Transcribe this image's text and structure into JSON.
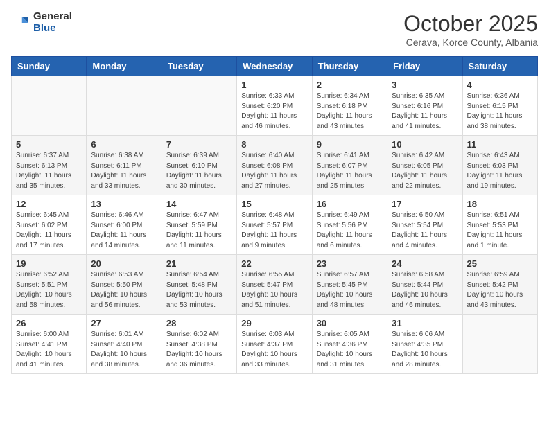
{
  "logo": {
    "general": "General",
    "blue": "Blue"
  },
  "title": "October 2025",
  "subtitle": "Cerava, Korce County, Albania",
  "days_of_week": [
    "Sunday",
    "Monday",
    "Tuesday",
    "Wednesday",
    "Thursday",
    "Friday",
    "Saturday"
  ],
  "weeks": [
    [
      {
        "day": "",
        "info": ""
      },
      {
        "day": "",
        "info": ""
      },
      {
        "day": "",
        "info": ""
      },
      {
        "day": "1",
        "info": "Sunrise: 6:33 AM\nSunset: 6:20 PM\nDaylight: 11 hours and 46 minutes."
      },
      {
        "day": "2",
        "info": "Sunrise: 6:34 AM\nSunset: 6:18 PM\nDaylight: 11 hours and 43 minutes."
      },
      {
        "day": "3",
        "info": "Sunrise: 6:35 AM\nSunset: 6:16 PM\nDaylight: 11 hours and 41 minutes."
      },
      {
        "day": "4",
        "info": "Sunrise: 6:36 AM\nSunset: 6:15 PM\nDaylight: 11 hours and 38 minutes."
      }
    ],
    [
      {
        "day": "5",
        "info": "Sunrise: 6:37 AM\nSunset: 6:13 PM\nDaylight: 11 hours and 35 minutes."
      },
      {
        "day": "6",
        "info": "Sunrise: 6:38 AM\nSunset: 6:11 PM\nDaylight: 11 hours and 33 minutes."
      },
      {
        "day": "7",
        "info": "Sunrise: 6:39 AM\nSunset: 6:10 PM\nDaylight: 11 hours and 30 minutes."
      },
      {
        "day": "8",
        "info": "Sunrise: 6:40 AM\nSunset: 6:08 PM\nDaylight: 11 hours and 27 minutes."
      },
      {
        "day": "9",
        "info": "Sunrise: 6:41 AM\nSunset: 6:07 PM\nDaylight: 11 hours and 25 minutes."
      },
      {
        "day": "10",
        "info": "Sunrise: 6:42 AM\nSunset: 6:05 PM\nDaylight: 11 hours and 22 minutes."
      },
      {
        "day": "11",
        "info": "Sunrise: 6:43 AM\nSunset: 6:03 PM\nDaylight: 11 hours and 19 minutes."
      }
    ],
    [
      {
        "day": "12",
        "info": "Sunrise: 6:45 AM\nSunset: 6:02 PM\nDaylight: 11 hours and 17 minutes."
      },
      {
        "day": "13",
        "info": "Sunrise: 6:46 AM\nSunset: 6:00 PM\nDaylight: 11 hours and 14 minutes."
      },
      {
        "day": "14",
        "info": "Sunrise: 6:47 AM\nSunset: 5:59 PM\nDaylight: 11 hours and 11 minutes."
      },
      {
        "day": "15",
        "info": "Sunrise: 6:48 AM\nSunset: 5:57 PM\nDaylight: 11 hours and 9 minutes."
      },
      {
        "day": "16",
        "info": "Sunrise: 6:49 AM\nSunset: 5:56 PM\nDaylight: 11 hours and 6 minutes."
      },
      {
        "day": "17",
        "info": "Sunrise: 6:50 AM\nSunset: 5:54 PM\nDaylight: 11 hours and 4 minutes."
      },
      {
        "day": "18",
        "info": "Sunrise: 6:51 AM\nSunset: 5:53 PM\nDaylight: 11 hours and 1 minute."
      }
    ],
    [
      {
        "day": "19",
        "info": "Sunrise: 6:52 AM\nSunset: 5:51 PM\nDaylight: 10 hours and 58 minutes."
      },
      {
        "day": "20",
        "info": "Sunrise: 6:53 AM\nSunset: 5:50 PM\nDaylight: 10 hours and 56 minutes."
      },
      {
        "day": "21",
        "info": "Sunrise: 6:54 AM\nSunset: 5:48 PM\nDaylight: 10 hours and 53 minutes."
      },
      {
        "day": "22",
        "info": "Sunrise: 6:55 AM\nSunset: 5:47 PM\nDaylight: 10 hours and 51 minutes."
      },
      {
        "day": "23",
        "info": "Sunrise: 6:57 AM\nSunset: 5:45 PM\nDaylight: 10 hours and 48 minutes."
      },
      {
        "day": "24",
        "info": "Sunrise: 6:58 AM\nSunset: 5:44 PM\nDaylight: 10 hours and 46 minutes."
      },
      {
        "day": "25",
        "info": "Sunrise: 6:59 AM\nSunset: 5:42 PM\nDaylight: 10 hours and 43 minutes."
      }
    ],
    [
      {
        "day": "26",
        "info": "Sunrise: 6:00 AM\nSunset: 4:41 PM\nDaylight: 10 hours and 41 minutes."
      },
      {
        "day": "27",
        "info": "Sunrise: 6:01 AM\nSunset: 4:40 PM\nDaylight: 10 hours and 38 minutes."
      },
      {
        "day": "28",
        "info": "Sunrise: 6:02 AM\nSunset: 4:38 PM\nDaylight: 10 hours and 36 minutes."
      },
      {
        "day": "29",
        "info": "Sunrise: 6:03 AM\nSunset: 4:37 PM\nDaylight: 10 hours and 33 minutes."
      },
      {
        "day": "30",
        "info": "Sunrise: 6:05 AM\nSunset: 4:36 PM\nDaylight: 10 hours and 31 minutes."
      },
      {
        "day": "31",
        "info": "Sunrise: 6:06 AM\nSunset: 4:35 PM\nDaylight: 10 hours and 28 minutes."
      },
      {
        "day": "",
        "info": ""
      }
    ]
  ]
}
